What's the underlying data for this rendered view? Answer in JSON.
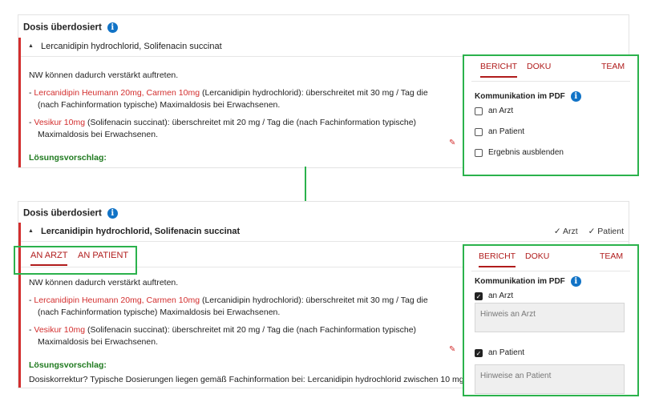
{
  "top": {
    "title": "Dosis überdosiert",
    "drug_title": "Lercanidipin hydrochlorid, Solifenacin succinat",
    "intro": "NW können dadurch verstärkt auftreten.",
    "bullet1_prefix": "- ",
    "bullet1_red": "Lercanidipin Heumann 20mg, Carmen 10mg",
    "bullet1_text": " (Lercanidipin hydrochlorid): überschreitet mit 30 mg / Tag die (nach Fachinformation typische) Maximaldosis bei Erwachsenen.",
    "bullet2_prefix": "- ",
    "bullet2_red": "Vesikur 10mg",
    "bullet2_text": " (Solifenacin succinat): überschreitet mit 20 mg / Tag die (nach Fachinformation typische) Maximaldosis bei Erwachsenen.",
    "loesung": "Lösungsvorschlag:"
  },
  "top_sidebar": {
    "tabs": [
      "BERICHT",
      "DOKU",
      "TEAM"
    ],
    "section_label": "Kommunikation im PDF",
    "options": [
      "an Arzt",
      "an Patient",
      "Ergebnis ausblenden"
    ]
  },
  "bottom": {
    "title": "Dosis überdosiert",
    "drug_title": "Lercanidipin hydrochlorid, Solifenacin succinat",
    "status_arzt": "✓ Arzt",
    "status_patient": "✓ Patient",
    "tabs": [
      "AN ARZT",
      "AN PATIENT"
    ],
    "intro": "NW können dadurch verstärkt auftreten.",
    "bullet1_prefix": "- ",
    "bullet1_red": "Lercanidipin Heumann 20mg, Carmen 10mg",
    "bullet1_text": " (Lercanidipin hydrochlorid): überschreitet mit 30 mg / Tag die (nach Fachinformation typische) Maximaldosis bei Erwachsenen.",
    "bullet2_prefix": "- ",
    "bullet2_red": "Vesikur 10mg",
    "bullet2_text": " (Solifenacin succinat): überschreitet mit 20 mg / Tag die (nach Fachinformation typische) Maximaldosis bei Erwachsenen.",
    "loesung": "Lösungsvorschlag:",
    "dosis_text": "Dosiskorrektur? Typische Dosierungen liegen gemäß Fachinformation bei: Lercanidipin hydrochlorid zwischen 10 mg"
  },
  "bottom_sidebar": {
    "tabs": [
      "BERICHT",
      "DOKU",
      "TEAM"
    ],
    "section_label": "Kommunikation im PDF",
    "option_arzt": "an Arzt",
    "hint_arzt": "Hinweis an Arzt",
    "option_patient": "an Patient",
    "hint_patient": "Hinweise an Patient"
  },
  "icons": {
    "info": "info-icon",
    "pencil": "pencil-icon",
    "caret": "caret-up-icon",
    "check": "check-icon"
  },
  "colors": {
    "accent_red": "#b01c1c",
    "highlight_green": "#2bb24c",
    "info_blue": "#1173c6",
    "solution_green": "#1f7a1f"
  }
}
